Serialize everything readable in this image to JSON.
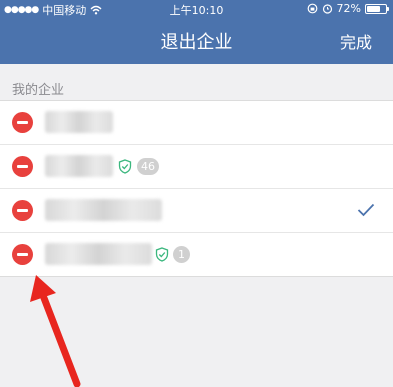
{
  "status_bar": {
    "signal_dots": "●●●●●",
    "carrier": "中国移动",
    "time": "上午10:10",
    "battery_percent": "72%",
    "battery_level": 0.72,
    "icons": [
      "wifi-icon",
      "rotation-lock-icon",
      "alarm-icon",
      "battery-icon"
    ]
  },
  "navbar": {
    "title": "退出企业",
    "done_label": "完成"
  },
  "section": {
    "label": "我的企业"
  },
  "companies": [
    {
      "verified": false,
      "badge": null,
      "selected": false
    },
    {
      "verified": true,
      "badge": "46",
      "selected": false
    },
    {
      "verified": false,
      "badge": null,
      "selected": true
    },
    {
      "verified": true,
      "badge": "1",
      "selected": false
    }
  ],
  "colors": {
    "header": "#4b73ad",
    "delete": "#e8413d",
    "verified": "#3bb77e",
    "check": "#4b73ad",
    "annotation_arrow": "#e8261f"
  }
}
